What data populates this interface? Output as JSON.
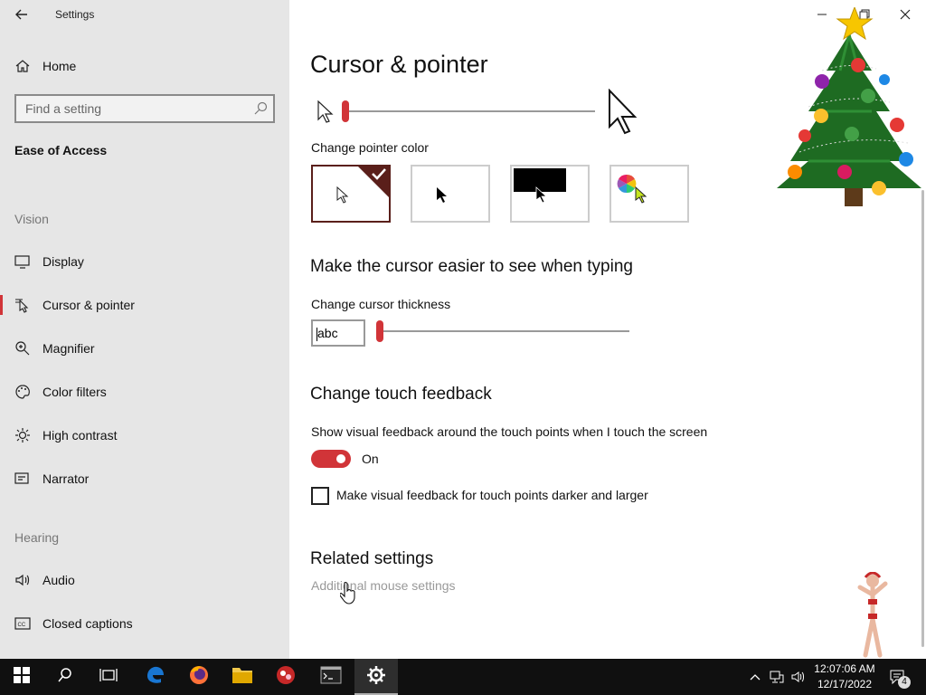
{
  "window": {
    "title": "Settings"
  },
  "sidebar": {
    "home_label": "Home",
    "search_placeholder": "Find a setting",
    "category": "Ease of Access",
    "vision_header": "Vision",
    "vision_items": [
      {
        "label": "Display",
        "icon": "display-icon"
      },
      {
        "label": "Cursor & pointer",
        "icon": "cursor-pointer-icon",
        "active": true
      },
      {
        "label": "Magnifier",
        "icon": "magnifier-icon"
      },
      {
        "label": "Color filters",
        "icon": "color-filters-icon"
      },
      {
        "label": "High contrast",
        "icon": "high-contrast-icon"
      },
      {
        "label": "Narrator",
        "icon": "narrator-icon"
      }
    ],
    "hearing_header": "Hearing",
    "hearing_items": [
      {
        "label": "Audio",
        "icon": "audio-icon"
      },
      {
        "label": "Closed captions",
        "icon": "closed-captions-icon"
      }
    ]
  },
  "main": {
    "title": "Cursor & pointer",
    "pointer_size_level": 0,
    "pointer_color_label": "Change pointer color",
    "pointer_color_options": [
      "white",
      "black",
      "inverted",
      "custom"
    ],
    "pointer_color_selected": "white",
    "typing_header": "Make the cursor easier to see when typing",
    "thickness_label": "Change cursor thickness",
    "thickness_preview": "abc",
    "thickness_level": 0,
    "touch_header": "Change touch feedback",
    "touch_desc": "Show visual feedback around the touch points when I touch the screen",
    "touch_toggle_state": "On",
    "touch_darker_label": "Make visual feedback for touch points darker and larger",
    "touch_darker_checked": false,
    "related_header": "Related settings",
    "related_link": "Additional mouse settings"
  },
  "taskbar": {
    "time": "12:07:06 AM",
    "date": "12/17/2022",
    "notification_count": "4"
  },
  "colors": {
    "accent": "#d13438",
    "sidebar_bg": "#e6e6e6",
    "taskbar_bg": "#101010"
  }
}
